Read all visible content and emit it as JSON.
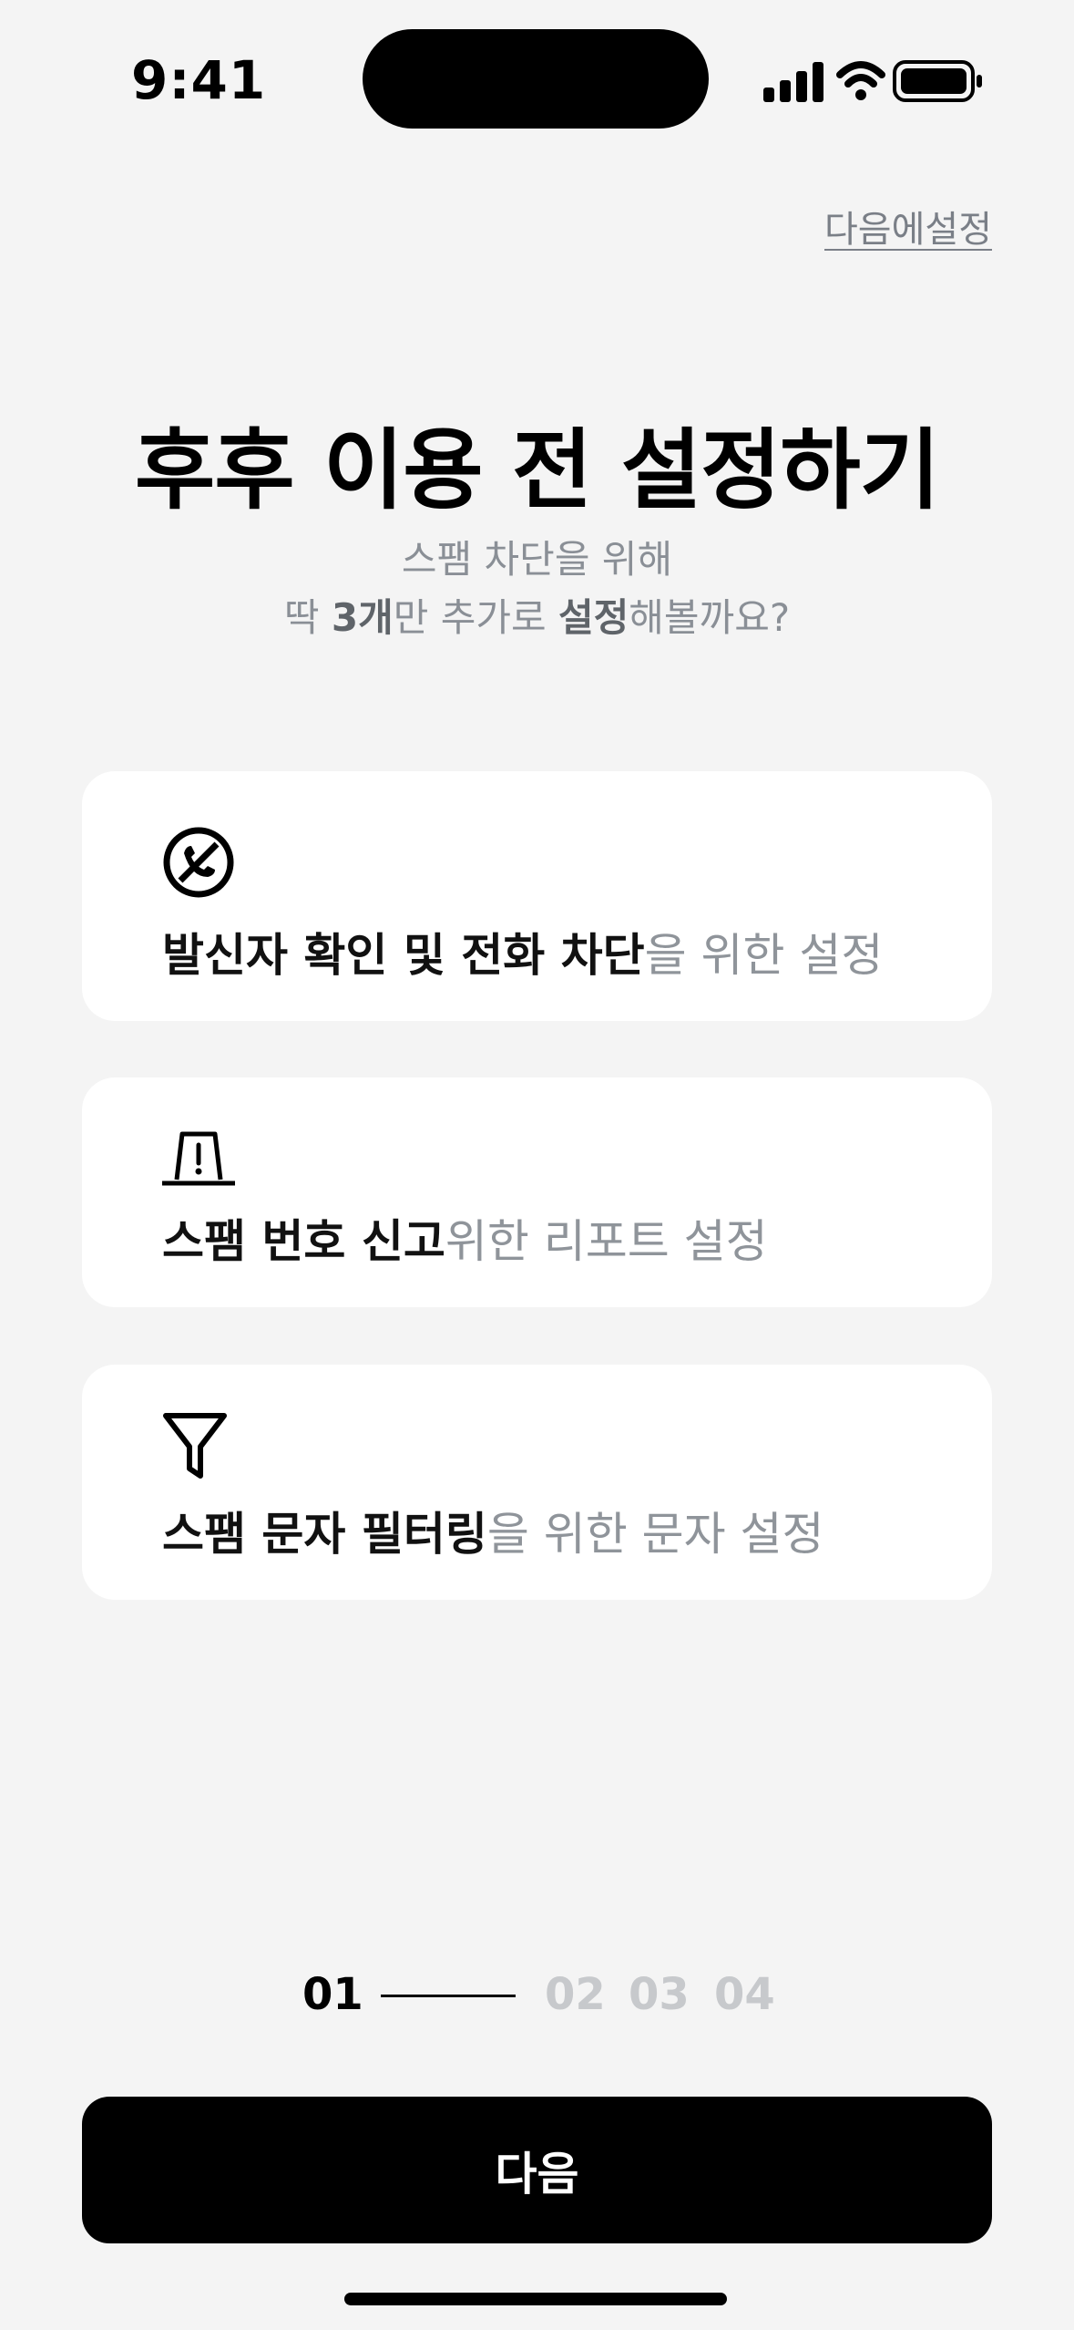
{
  "status_bar": {
    "time": "9:41",
    "signal_icon": "cellular-signal-icon",
    "wifi_icon": "wifi-icon",
    "battery_icon": "battery-icon"
  },
  "skip_label": "다음에설정",
  "title": "후후 이용 전 설정하기",
  "subtitle": {
    "line1": "스팸 차단을 위해",
    "line2_a": "딱 ",
    "line2_b": "3개",
    "line2_c": "만 추가로 ",
    "line2_d": "설정",
    "line2_e": "해볼까요?"
  },
  "cards": [
    {
      "icon": "call-block-icon",
      "strong": "발신자 확인 및 전화 차단",
      "rest": "을 위한 설정"
    },
    {
      "icon": "report-siren-icon",
      "strong": "스팸 번호 신고",
      "rest": "위한 리포트 설정"
    },
    {
      "icon": "filter-icon",
      "strong": "스팸 문자 필터링",
      "rest": "을 위한 문자 설정"
    }
  ],
  "steps": {
    "current": "01",
    "items": [
      "02",
      "03",
      "04"
    ]
  },
  "next_button_label": "다음"
}
